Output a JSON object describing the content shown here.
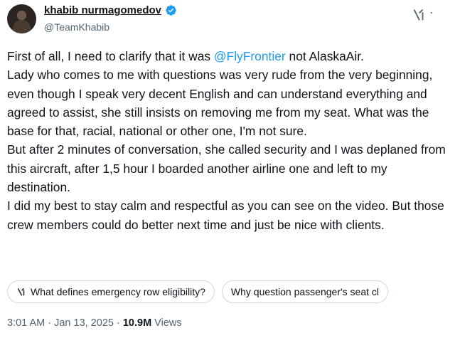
{
  "author": {
    "name": "khabib nurmagomedov",
    "handle": "@TeamKhabib",
    "verified": true
  },
  "icons": {
    "grok": "grok-icon",
    "more": "more-options-icon",
    "verified": "verified-badge-icon"
  },
  "tweet": {
    "line1_pre": "First of all, I need to clarify that it was ",
    "mention": "@FlyFrontier",
    "line1_post": " not AlaskaAir.",
    "para2": "Lady who comes to me with questions was very rude from the very beginning, even though I speak very decent English and can understand everything and agreed to assist, she still insists on removing me from my seat. What was the base for that, racial, national or other one, I'm not sure.",
    "para3": "But after 2 minutes of conversation, she called security and I was deplaned from this aircraft, after 1,5 hour I boarded another airline one and left to my destination.",
    "para4": "I did my best to stay calm and respectful as you can see on the video. But those crew members could do better next time and just be nice with clients."
  },
  "grok_suggestions": [
    "What defines emergency row eligibility?",
    "Why question passenger's seat cl"
  ],
  "meta": {
    "time": "3:01 AM",
    "separator1": " · ",
    "date": "Jan 13, 2025",
    "separator2": " · ",
    "views_count": "10.9M",
    "views_label": " Views"
  },
  "colors": {
    "mention": "#1d9bf0",
    "verified": "#1d9bf0",
    "secondary_text": "#536471"
  }
}
